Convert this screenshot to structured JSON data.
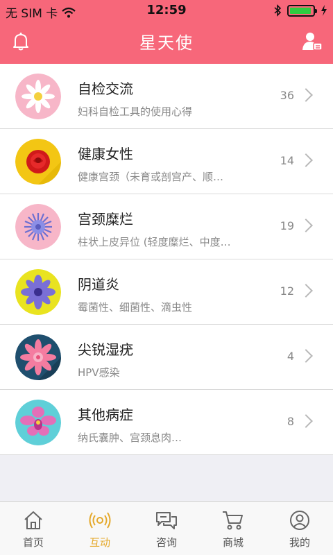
{
  "status_bar": {
    "carrier": "无 SIM 卡",
    "time": "12:59"
  },
  "header": {
    "title": "星天使",
    "left_icon": "bell-icon",
    "right_icon": "user-settings-icon",
    "accent_color": "#f7677a"
  },
  "list": [
    {
      "title": "自检交流",
      "subtitle": "妇科自检工具的使用心得",
      "count": "36",
      "icon": "daisy-flower-icon"
    },
    {
      "title": "健康女性",
      "subtitle": "健康宫颈（未育或剖宫产、顺…",
      "count": "14",
      "icon": "red-rose-icon"
    },
    {
      "title": "宫颈糜烂",
      "subtitle": "柱状上皮异位 (轻度糜烂、中度…",
      "count": "19",
      "icon": "aster-flower-icon"
    },
    {
      "title": "阴道炎",
      "subtitle": "霉菌性、细菌性、滴虫性",
      "count": "12",
      "icon": "purple-flower-icon"
    },
    {
      "title": "尖锐湿疣",
      "subtitle": "HPV感染",
      "count": "4",
      "icon": "pink-lotus-icon"
    },
    {
      "title": "其他病症",
      "subtitle": "纳氏囊肿、宫颈息肉…",
      "count": "8",
      "icon": "orchid-icon"
    }
  ],
  "tabs": [
    {
      "label": "首页",
      "icon": "home-icon",
      "active": false
    },
    {
      "label": "互动",
      "icon": "broadcast-icon",
      "active": true
    },
    {
      "label": "咨询",
      "icon": "chat-icon",
      "active": false
    },
    {
      "label": "商城",
      "icon": "cart-icon",
      "active": false
    },
    {
      "label": "我的",
      "icon": "profile-icon",
      "active": false
    }
  ],
  "tab_active_color": "#e5a92b"
}
